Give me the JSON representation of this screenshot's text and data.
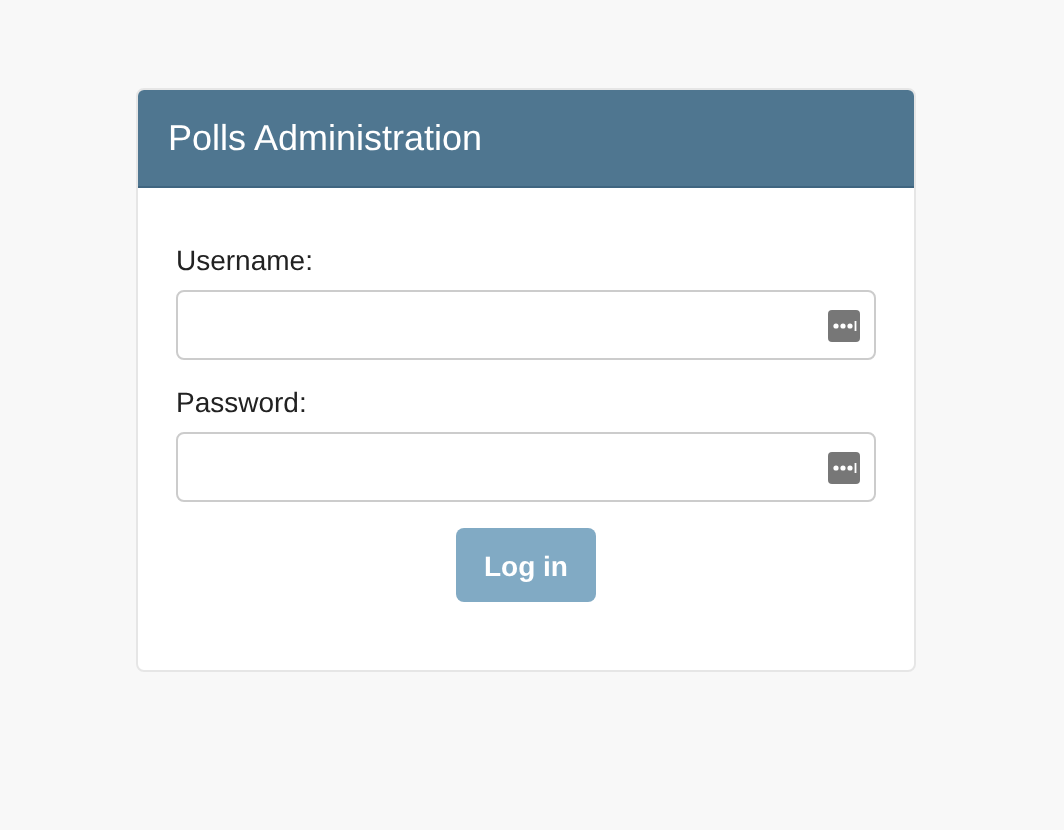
{
  "header": {
    "title": "Polls Administration"
  },
  "fields": [
    {
      "label": "Username:"
    },
    {
      "label": "Password:"
    }
  ],
  "submit": {
    "label": "Log in"
  }
}
